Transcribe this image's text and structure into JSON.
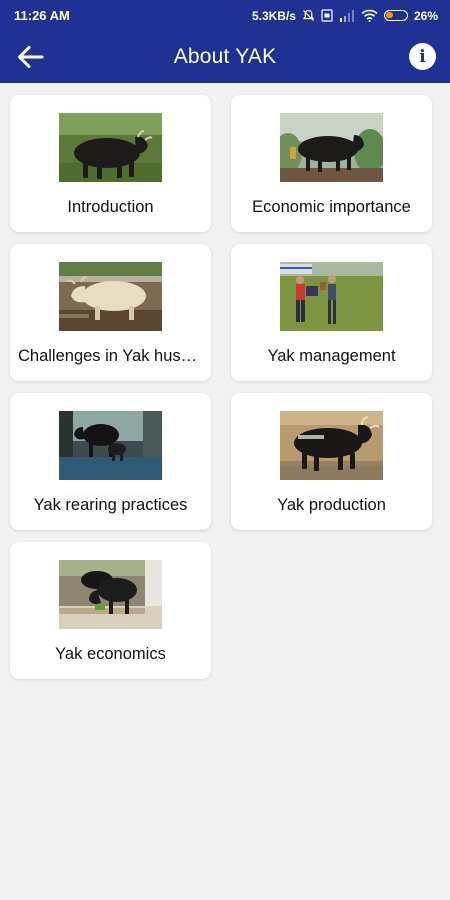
{
  "status_bar": {
    "time": "11:26 AM",
    "speed": "5.3KB/s",
    "battery": "26%",
    "icons": [
      "mute-icon",
      "sim-icon",
      "signal-icon",
      "wifi-icon",
      "battery-icon"
    ],
    "battery_color": "#ff9800"
  },
  "app_bar": {
    "title": "About YAK",
    "back_icon": "back-arrow-icon",
    "info_icon": "info-icon",
    "info_glyph": "i",
    "color": "#1f3294"
  },
  "cards": [
    {
      "label": "Introduction"
    },
    {
      "label": "Economic importance"
    },
    {
      "label": "Challenges in Yak husbandry"
    },
    {
      "label": "Yak management"
    },
    {
      "label": "Yak rearing practices"
    },
    {
      "label": "Yak production"
    },
    {
      "label": "Yak economics"
    }
  ]
}
